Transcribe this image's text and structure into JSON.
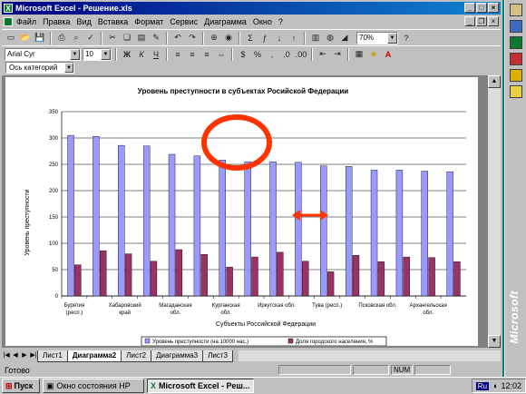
{
  "window": {
    "title": "Microsoft Excel - Решение.xls"
  },
  "menu": [
    {
      "label": "Файл"
    },
    {
      "label": "Правка"
    },
    {
      "label": "Вид"
    },
    {
      "label": "Вставка"
    },
    {
      "label": "Формат"
    },
    {
      "label": "Сервис"
    },
    {
      "label": "Диаграмма"
    },
    {
      "label": "Окно"
    },
    {
      "label": "?"
    }
  ],
  "toolbar": {
    "zoom": "70%"
  },
  "format_toolbar": {
    "font": "Arial Cyr",
    "size": "10",
    "bold": "Ж",
    "italic": "К",
    "underline": "Ч"
  },
  "namebox": {
    "value": "Ось категорий"
  },
  "chart_data": {
    "type": "bar",
    "title": "Уровень преступности в субъектах Росийской Федерации",
    "xlabel": "Субъекты Российской Федерации",
    "ylabel": "Уровень преступности",
    "ylim": [
      0,
      350
    ],
    "yticks": [
      "0",
      "50",
      "100",
      "150",
      "200",
      "250",
      "300",
      "350"
    ],
    "category_labels": [
      {
        "i": 0,
        "lines": [
          "Бурятия",
          "(респ.)"
        ]
      },
      {
        "i": 2,
        "lines": [
          "Хабаровский",
          "край"
        ]
      },
      {
        "i": 4,
        "lines": [
          "Магаданская",
          "обл."
        ]
      },
      {
        "i": 6,
        "lines": [
          "Курганская",
          "обл."
        ]
      },
      {
        "i": 8,
        "lines": [
          "Иркутская обл."
        ]
      },
      {
        "i": 10,
        "lines": [
          "Тува (респ.)"
        ]
      },
      {
        "i": 12,
        "lines": [
          "Псковская обл."
        ]
      },
      {
        "i": 14,
        "lines": [
          "Архангельская",
          "обл."
        ]
      }
    ],
    "series": [
      {
        "name": "Уровень преступности (на 10000 нас.)",
        "color": "#9999ff",
        "values": [
          305,
          303,
          286,
          285,
          269,
          266,
          258,
          255,
          255,
          254,
          247,
          246,
          239,
          239,
          237,
          236
        ]
      },
      {
        "name": "Доля городского населения, %",
        "color": "#993366",
        "values": [
          59,
          86,
          80,
          66,
          88,
          79,
          55,
          74,
          83,
          66,
          46,
          77,
          65,
          74,
          73,
          65
        ]
      }
    ],
    "legend_position": "bottom",
    "grid": true
  },
  "sheets": [
    {
      "label": "Лист1",
      "active": false
    },
    {
      "label": "Диаграмма2",
      "active": true
    },
    {
      "label": "Лист2",
      "active": false
    },
    {
      "label": "Диаграмма3",
      "active": false
    },
    {
      "label": "Лист3",
      "active": false
    }
  ],
  "status": {
    "ready": "Готово",
    "num": "NUM"
  },
  "taskbar": {
    "start": "Пуск",
    "tasks": [
      "Окно состояния HP",
      "Microsoft Excel - Реш..."
    ],
    "lang": "Ru",
    "clock": "12:02"
  },
  "office_label": "Microsoft"
}
